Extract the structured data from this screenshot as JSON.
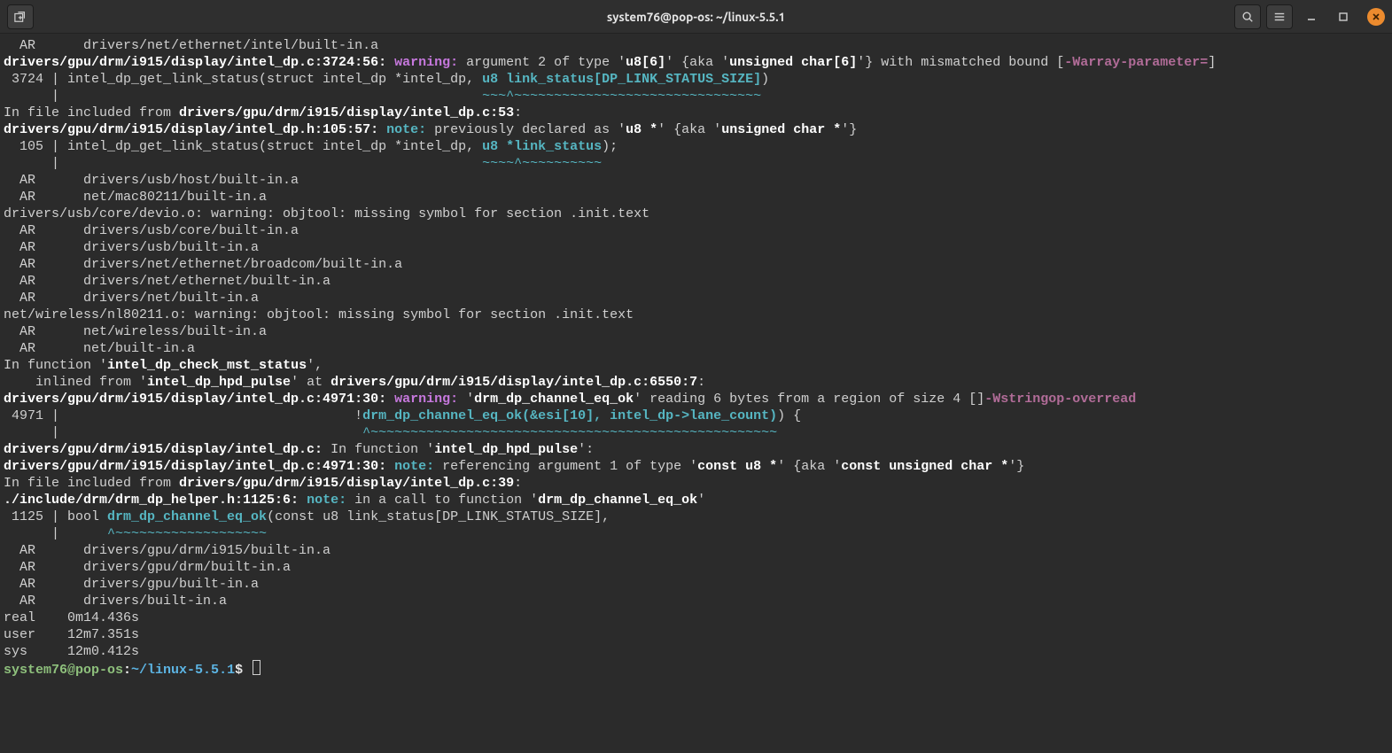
{
  "title": "system76@pop-os: ~/linux-5.5.1",
  "prompt": {
    "user": "system76@pop-os",
    "sep": ":",
    "path": "~/linux-5.5.1",
    "dollar": "$"
  },
  "colors": {
    "bg": "#2b2b2b",
    "fg": "#d0d0d0",
    "bold": "#ffffff",
    "magenta": "#c678dd",
    "cyan": "#56b6c2",
    "promptUser": "#8ec07c",
    "promptPath": "#5cb4e3",
    "close": "#ec8b2e"
  },
  "lines": [
    {
      "t": "ar",
      "txt": "  AR      drivers/net/ethernet/intel/built-in.a"
    },
    {
      "t": "warn",
      "loc": "drivers/gpu/drm/i915/display/intel_dp.c:3724:56:",
      "label": "warning:",
      "msg1": " argument 2 of type '",
      "b1": "u8[6]",
      "msg2": "' {aka '",
      "b2": "unsigned char[6]",
      "msg3": "'} with mismatched bound [",
      "flag": "-Warray-parameter=",
      "msg4": "]"
    },
    {
      "t": "code",
      "lineno": " 3724 |",
      "pre": " intel_dp_get_link_status(struct intel_dp *intel_dp, ",
      "hl": "u8 link_status[DP_LINK_STATUS_SIZE]",
      "post": ")"
    },
    {
      "t": "markers",
      "pad": "      |                                                     ",
      "marks": "~~~^~~~~~~~~~~~~~~~~~~~~~~~~~~~~~~~"
    },
    {
      "t": "plainmix",
      "pre": "In file included from ",
      "b": "drivers/gpu/drm/i915/display/intel_dp.c:53",
      "post": ":"
    },
    {
      "t": "note",
      "loc": "drivers/gpu/drm/i915/display/intel_dp.h:105:57:",
      "label": "note:",
      "msg1": " previously declared as '",
      "b1": "u8 *",
      "msg2": "' {aka '",
      "b2": "unsigned char *",
      "msg3": "'}"
    },
    {
      "t": "code",
      "lineno": "  105 |",
      "pre": " intel_dp_get_link_status(struct intel_dp *intel_dp, ",
      "hl": "u8 *link_status",
      "post": ");"
    },
    {
      "t": "markers",
      "pad": "      |                                                     ",
      "marks": "~~~~^~~~~~~~~~~"
    },
    {
      "t": "ar",
      "txt": "  AR      drivers/usb/host/built-in.a"
    },
    {
      "t": "ar",
      "txt": "  AR      net/mac80211/built-in.a"
    },
    {
      "t": "plain",
      "txt": "drivers/usb/core/devio.o: warning: objtool: missing symbol for section .init.text"
    },
    {
      "t": "ar",
      "txt": "  AR      drivers/usb/core/built-in.a"
    },
    {
      "t": "ar",
      "txt": "  AR      drivers/usb/built-in.a"
    },
    {
      "t": "ar",
      "txt": "  AR      drivers/net/ethernet/broadcom/built-in.a"
    },
    {
      "t": "ar",
      "txt": "  AR      drivers/net/ethernet/built-in.a"
    },
    {
      "t": "ar",
      "txt": "  AR      drivers/net/built-in.a"
    },
    {
      "t": "plain",
      "txt": "net/wireless/nl80211.o: warning: objtool: missing symbol for section .init.text"
    },
    {
      "t": "ar",
      "txt": "  AR      net/wireless/built-in.a"
    },
    {
      "t": "ar",
      "txt": "  AR      net/built-in.a"
    },
    {
      "t": "plainmix",
      "pre": "In function '",
      "b": "intel_dp_check_mst_status",
      "post": "',"
    },
    {
      "t": "inlined",
      "pre": "    inlined from '",
      "b1": "intel_dp_hpd_pulse",
      "mid": "' at ",
      "b2": "drivers/gpu/drm/i915/display/intel_dp.c:6550:7",
      "post": ":"
    },
    {
      "t": "warn",
      "loc": "drivers/gpu/drm/i915/display/intel_dp.c:4971:30:",
      "label": "warning:",
      "msg1": " '",
      "b1": "drm_dp_channel_eq_ok",
      "msg2": "' reading 6 bytes from a region of size 4 [",
      "flag": "-Wstringop-overread",
      "msg3": "]"
    },
    {
      "t": "code",
      "lineno": " 4971 |",
      "pre": "                                     !",
      "hl": "drm_dp_channel_eq_ok(&esi[10], intel_dp->lane_count)",
      "post": ") {"
    },
    {
      "t": "markers",
      "pad": "      |                                      ",
      "marks": "^~~~~~~~~~~~~~~~~~~~~~~~~~~~~~~~~~~~~~~~~~~~~~~~~~~~"
    },
    {
      "t": "plainmix2",
      "loc": "drivers/gpu/drm/i915/display/intel_dp.c:",
      "msg": " In function '",
      "b": "intel_dp_hpd_pulse",
      "post": "':"
    },
    {
      "t": "note",
      "loc": "drivers/gpu/drm/i915/display/intel_dp.c:4971:30:",
      "label": "note:",
      "msg1": " referencing argument 1 of type '",
      "b1": "const u8 *",
      "msg2": "' {aka '",
      "b2": "const unsigned char *",
      "msg3": "'}"
    },
    {
      "t": "plainmix",
      "pre": "In file included from ",
      "b": "drivers/gpu/drm/i915/display/intel_dp.c:39",
      "post": ":"
    },
    {
      "t": "note",
      "loc": "./include/drm/drm_dp_helper.h:1125:6:",
      "label": "note:",
      "msg1": " in a call to function '",
      "b1": "drm_dp_channel_eq_ok",
      "msg2": "'"
    },
    {
      "t": "code",
      "lineno": " 1125 |",
      "pre": " bool ",
      "hl": "drm_dp_channel_eq_ok",
      "post": "(const u8 link_status[DP_LINK_STATUS_SIZE],"
    },
    {
      "t": "markers",
      "pad": "      |      ",
      "marks": "^~~~~~~~~~~~~~~~~~~~"
    },
    {
      "t": "ar",
      "txt": "  AR      drivers/gpu/drm/i915/built-in.a"
    },
    {
      "t": "ar",
      "txt": "  AR      drivers/gpu/drm/built-in.a"
    },
    {
      "t": "ar",
      "txt": "  AR      drivers/gpu/built-in.a"
    },
    {
      "t": "ar",
      "txt": "  AR      drivers/built-in.a"
    },
    {
      "t": "blank",
      "txt": ""
    },
    {
      "t": "plain",
      "txt": "real    0m14.436s"
    },
    {
      "t": "plain",
      "txt": "user    12m7.351s"
    },
    {
      "t": "plain",
      "txt": "sys     12m0.412s"
    }
  ]
}
